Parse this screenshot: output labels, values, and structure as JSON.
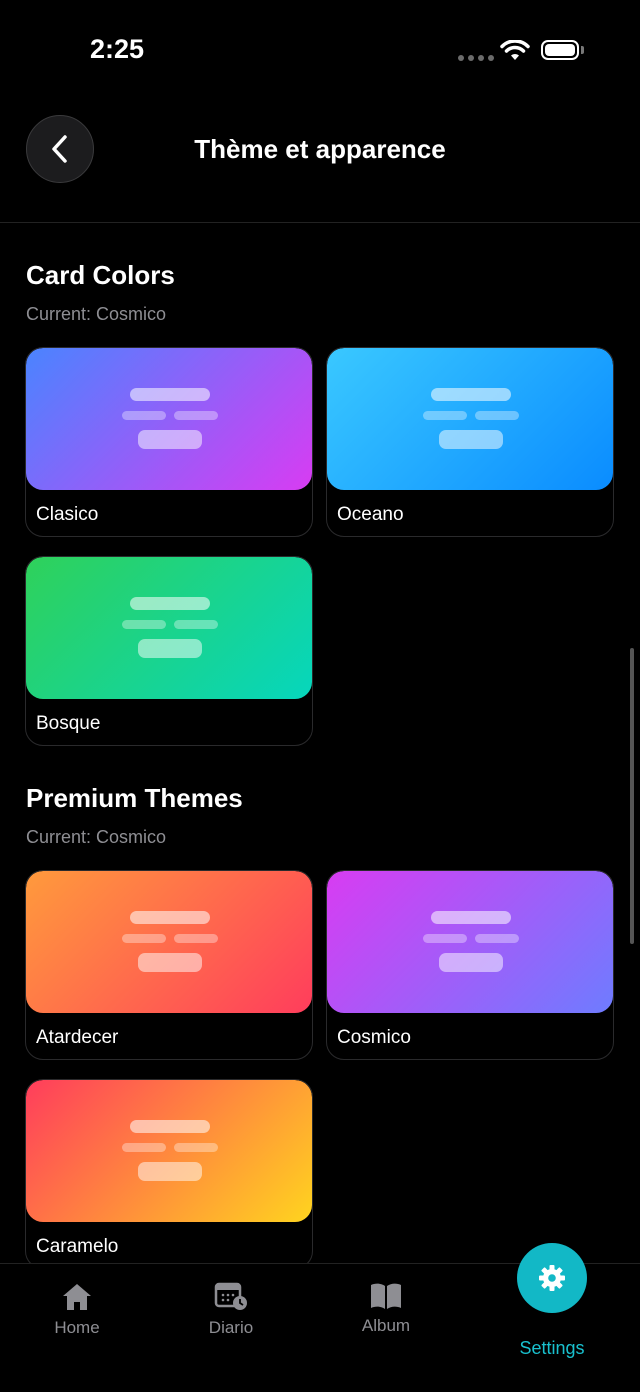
{
  "status": {
    "time": "2:25"
  },
  "header": {
    "title": "Thème et apparence"
  },
  "card_colors": {
    "title": "Card Colors",
    "current": "Current: Cosmico",
    "items": [
      {
        "label": "Clasico",
        "gradient": [
          "#4a84ff",
          "#d83cf2"
        ]
      },
      {
        "label": "Oceano",
        "gradient": [
          "#3ac8ff",
          "#0a8cff"
        ]
      },
      {
        "label": "Bosque",
        "gradient": [
          "#2fd15a",
          "#06d6bd"
        ]
      }
    ]
  },
  "premium_themes": {
    "title": "Premium Themes",
    "current": "Current: Cosmico",
    "items": [
      {
        "label": "Atardecer",
        "gradient": [
          "#ff9a3c",
          "#ff3d5c"
        ]
      },
      {
        "label": "Cosmico",
        "gradient": [
          "#d83cf2",
          "#6e7cff"
        ]
      },
      {
        "label": "Caramelo",
        "gradient": [
          "#ff3d5c",
          "#ffd41f"
        ]
      }
    ]
  },
  "tabs": [
    {
      "label": "Home",
      "icon": "home-icon"
    },
    {
      "label": "Diario",
      "icon": "calendar-clock-icon"
    },
    {
      "label": "Album",
      "icon": "book-icon"
    },
    {
      "label": "Settings",
      "icon": "gear-icon"
    }
  ],
  "colors": {
    "accent": "#12b8c6",
    "accent_text": "#19c1cf"
  }
}
